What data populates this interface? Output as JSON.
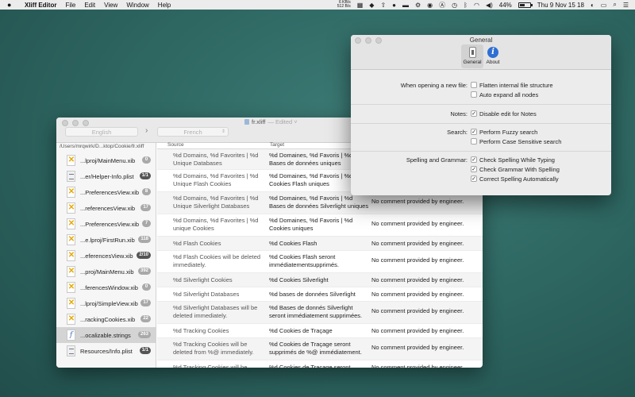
{
  "menubar": {
    "app_name": "Xliff Editor",
    "items": [
      "File",
      "Edit",
      "View",
      "Window",
      "Help"
    ],
    "net_up": "6 KB/s",
    "net_down": "512 B/s",
    "battery": "44%",
    "clock": "Thu 9 Nov  15 18"
  },
  "main_window": {
    "title": "fr.xliff",
    "edited": "— Edited ˅",
    "source_language": "English",
    "target_language": "French",
    "path": "/Users/mrqwirk/D...ktop/Cookie/fr.xliff",
    "columns": {
      "source": "Source",
      "target": "Target"
    },
    "files": [
      {
        "name": "...lproj/MainMenu.xib",
        "badge": "0",
        "icon": "xib"
      },
      {
        "name": "...er/Helper-Info.plist",
        "badge": "1/1",
        "icon": "plist",
        "dark": true
      },
      {
        "name": "...PreferencesView.xib",
        "badge": "8",
        "icon": "xib"
      },
      {
        "name": "...referencesView.xib",
        "badge": "17",
        "icon": "xib"
      },
      {
        "name": "...PreferencesView.xib",
        "badge": "7",
        "icon": "xib"
      },
      {
        "name": "...e.lproj/FirstRun.xib",
        "badge": "118",
        "icon": "xib"
      },
      {
        "name": "...eferencesView.xib",
        "badge": "2/10",
        "icon": "xib",
        "dark": true
      },
      {
        "name": "...proj/MainMenu.xib",
        "badge": "392",
        "icon": "xib"
      },
      {
        "name": "...ferencesWindow.xib",
        "badge": "0",
        "icon": "xib"
      },
      {
        "name": "...lproj/SimpleView.xib",
        "badge": "17",
        "icon": "xib"
      },
      {
        "name": "...rackingCookies.xib",
        "badge": "22",
        "icon": "xib"
      },
      {
        "name": "...ocalizable.strings",
        "badge": "263",
        "icon": "strings",
        "selected": true
      },
      {
        "name": "Resources/Info.plist",
        "badge": "1/1",
        "icon": "plist",
        "dark": true
      }
    ],
    "rows": [
      {
        "source": "%d Domains, %d Favorites | %d Unique Databases",
        "target": "%d Domaines, %d Favoris | %d Bases de données uniques",
        "comment": ""
      },
      {
        "source": "%d Domains, %d Favorites | %d Unique Flash Cookies",
        "target": "%d Domaines, %d Favoris | %d Cookies Flash uniques",
        "comment": ""
      },
      {
        "source": "%d Domains, %d Favorites | %d Unique Silverlight Databases",
        "target": "%d Domaines, %d Favoris | %d Bases de données Silverlight uniques",
        "comment": "No comment provided by engineer."
      },
      {
        "source": "%d Domains, %d Favorites | %d unique Cookies",
        "target": "%d Domaines, %d Favoris | %d Cookies uniques",
        "comment": "No comment provided by engineer."
      },
      {
        "source": "%d Flash Cookies",
        "target": "%d Cookies Flash",
        "comment": "No comment provided by engineer."
      },
      {
        "source": "%d Flash Cookies will be deleted immediately.",
        "target": "%d Cookies Flash seront immédiatementsupprimés.",
        "comment": "No comment provided by engineer."
      },
      {
        "source": "%d Silverlight Cookies",
        "target": "%d Cookies Silverlight",
        "comment": "No comment provided by engineer."
      },
      {
        "source": "%d Silverlight Databases",
        "target": "%d bases de données Silverlight",
        "comment": "No comment provided by engineer."
      },
      {
        "source": "%d Silverlight Databases will be deleted immediately.",
        "target": "%d Bases de donnés Silverlight seront immédiatement supprimées.",
        "comment": "No comment provided by engineer."
      },
      {
        "source": "%d Tracking Cookies",
        "target": "%d Cookies de Traçage",
        "comment": "No comment provided by engineer."
      },
      {
        "source": "%d Tracking Cookies will be deleted from %@ immediately.",
        "target": "%d Cookies de Traçage seront supprimés de %@ immédiatement.",
        "comment": "No comment provided by engineer."
      },
      {
        "source": "%d Tracking Cookies will be",
        "target": "%d Cookies de Traçage seront",
        "comment": "No comment provided by engineer."
      }
    ]
  },
  "prefs": {
    "title": "General",
    "tabs": {
      "general": "General",
      "about": "About"
    },
    "new_file_label": "When opening a new file:",
    "flatten": "Flatten internal file structure",
    "expand": "Auto expand all nodes",
    "notes_label": "Notes:",
    "disable_edit": "Disable edit for Notes",
    "search_label": "Search:",
    "fuzzy": "Perform Fuzzy search",
    "case_sensitive": "Perform Case Sensitive search",
    "spelling_label": "Spelling and Grammar:",
    "check_spelling": "Check Spelling While Typing",
    "check_grammar": "Check Grammar With Spelling",
    "correct_spelling": "Correct Spelling Automatically",
    "checked": {
      "flatten": false,
      "expand": false,
      "disable_edit": true,
      "fuzzy": true,
      "case_sensitive": false,
      "check_spelling": true,
      "check_grammar": true,
      "correct_spelling": true
    }
  }
}
